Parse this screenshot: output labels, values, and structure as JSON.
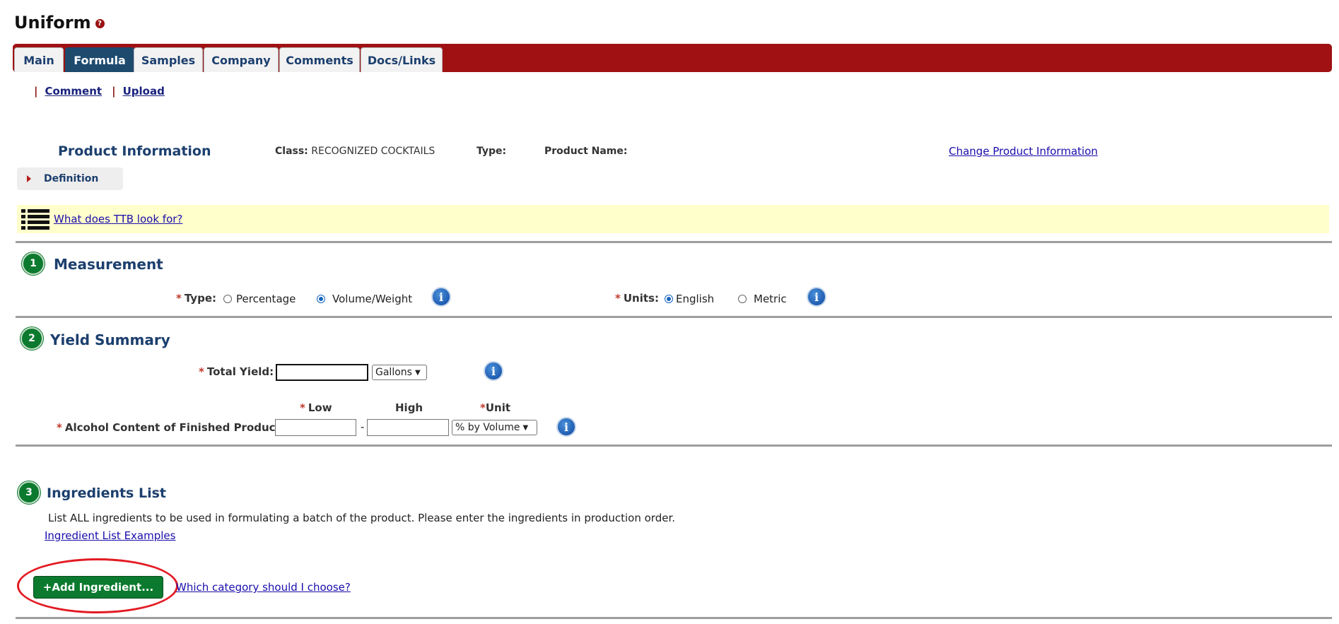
{
  "header": {
    "title": "Uniform",
    "help_icon": "help-question-icon"
  },
  "tabs": [
    {
      "label": "Main",
      "active": false
    },
    {
      "label": "Formula",
      "active": true
    },
    {
      "label": "Samples",
      "active": false
    },
    {
      "label": "Company",
      "active": false
    },
    {
      "label": "Comments",
      "active": false
    },
    {
      "label": "Docs/Links",
      "active": false
    }
  ],
  "sublinks": {
    "separator": "|",
    "comment": "Comment",
    "upload": "Upload"
  },
  "product_info": {
    "title": "Product Information",
    "class_label": "Class:",
    "class_value": "RECOGNIZED COCKTAILS",
    "type_label": "Type:",
    "type_value": "",
    "name_label": "Product Name:",
    "name_value": "",
    "change_link": "Change Product Information",
    "definition": "Definition"
  },
  "hint": {
    "icon": "list-icon",
    "link": "What does TTB look for?"
  },
  "required_mark": "*",
  "measurement": {
    "step": "1",
    "title": "Measurement",
    "type_label": "Type:",
    "type_options": [
      "Percentage",
      "Volume/Weight"
    ],
    "type_selected": "Volume/Weight",
    "units_label": "Units:",
    "units_options": [
      "English",
      "Metric"
    ],
    "units_selected": "English",
    "info_glyph": "i"
  },
  "yield_summary": {
    "step": "2",
    "title": "Yield Summary",
    "total_yield_label": "Total Yield:",
    "total_yield_value": "",
    "yield_unit": "Gallons",
    "col_low": "Low",
    "col_high": "High",
    "col_unit": "Unit",
    "alcohol_label": "Alcohol Content of Finished Product:",
    "low_value": "",
    "high_value": "",
    "range_sep": "-",
    "alcohol_unit": "% by Volume"
  },
  "ingredients": {
    "step": "3",
    "title": "Ingredients List",
    "description": "List ALL ingredients to be used in formulating a batch of the product. Please enter the ingredients in production order.",
    "examples_link": "Ingredient List Examples",
    "add_button": "+Add Ingredient...",
    "category_link": "Which category should I choose?"
  },
  "colors": {
    "tabbar": "#a01114",
    "active_tab": "#1e4a6e",
    "step_green": "#0b7a2e",
    "hint_bg": "#ffffcc",
    "annotation": "#e31b23"
  }
}
